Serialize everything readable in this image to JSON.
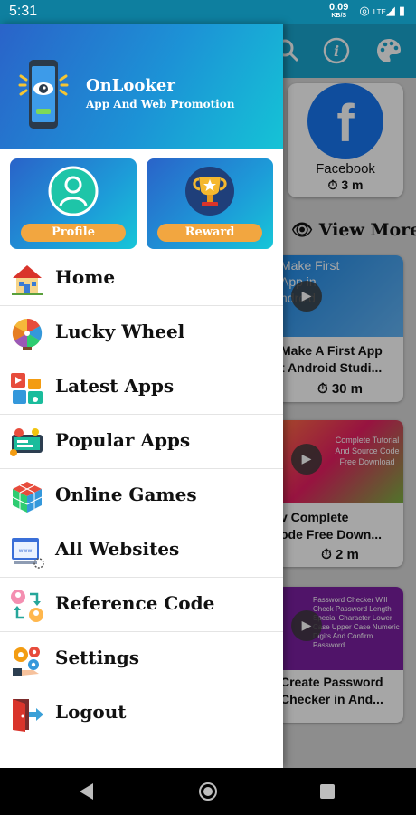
{
  "status_bar": {
    "time": "5:31",
    "speed_value": "0.09",
    "speed_unit": "KB/S",
    "network": "LTE"
  },
  "app": {
    "name": "OnLooker",
    "tagline": "App And Web Promotion"
  },
  "quick_tiles": [
    {
      "label": "Profile"
    },
    {
      "label": "Reward"
    }
  ],
  "menu": [
    {
      "label": "Home",
      "icon": "home-icon"
    },
    {
      "label": "Lucky Wheel",
      "icon": "lucky-wheel-icon"
    },
    {
      "label": "Latest Apps",
      "icon": "latest-apps-icon"
    },
    {
      "label": "Popular Apps",
      "icon": "popular-apps-icon"
    },
    {
      "label": "Online Games",
      "icon": "online-games-icon"
    },
    {
      "label": "All Websites",
      "icon": "websites-icon"
    },
    {
      "label": "Reference Code",
      "icon": "reference-code-icon"
    },
    {
      "label": "Settings",
      "icon": "settings-icon"
    },
    {
      "label": "Logout",
      "icon": "logout-icon"
    }
  ],
  "background": {
    "facebook_card": {
      "name": "Facebook",
      "time": "3 m"
    },
    "view_more": "View More",
    "videos": [
      {
        "title_line1": "Make A First App",
        "title_line2": "t Android Studi...",
        "time": "30 m",
        "thumb_text": "Make First App in ndroid"
      },
      {
        "title_line1": "v Complete",
        "title_line2": "ode Free Down...",
        "time": "2 m",
        "thumb_text": "Complete Tutorial And Source Code Free Download"
      },
      {
        "title_line1": "Create Password",
        "title_line2": "Checker in And...",
        "time": "",
        "thumb_text": "Password Checker Will Check Password Length Special Character Lower Case Upper Case Numeric Digits And Confirm Password"
      }
    ]
  },
  "colors": {
    "header_start": "#2a63c9",
    "header_end": "#15c3d6",
    "pill": "#f2a640",
    "status_bar": "#0e7f9f"
  }
}
